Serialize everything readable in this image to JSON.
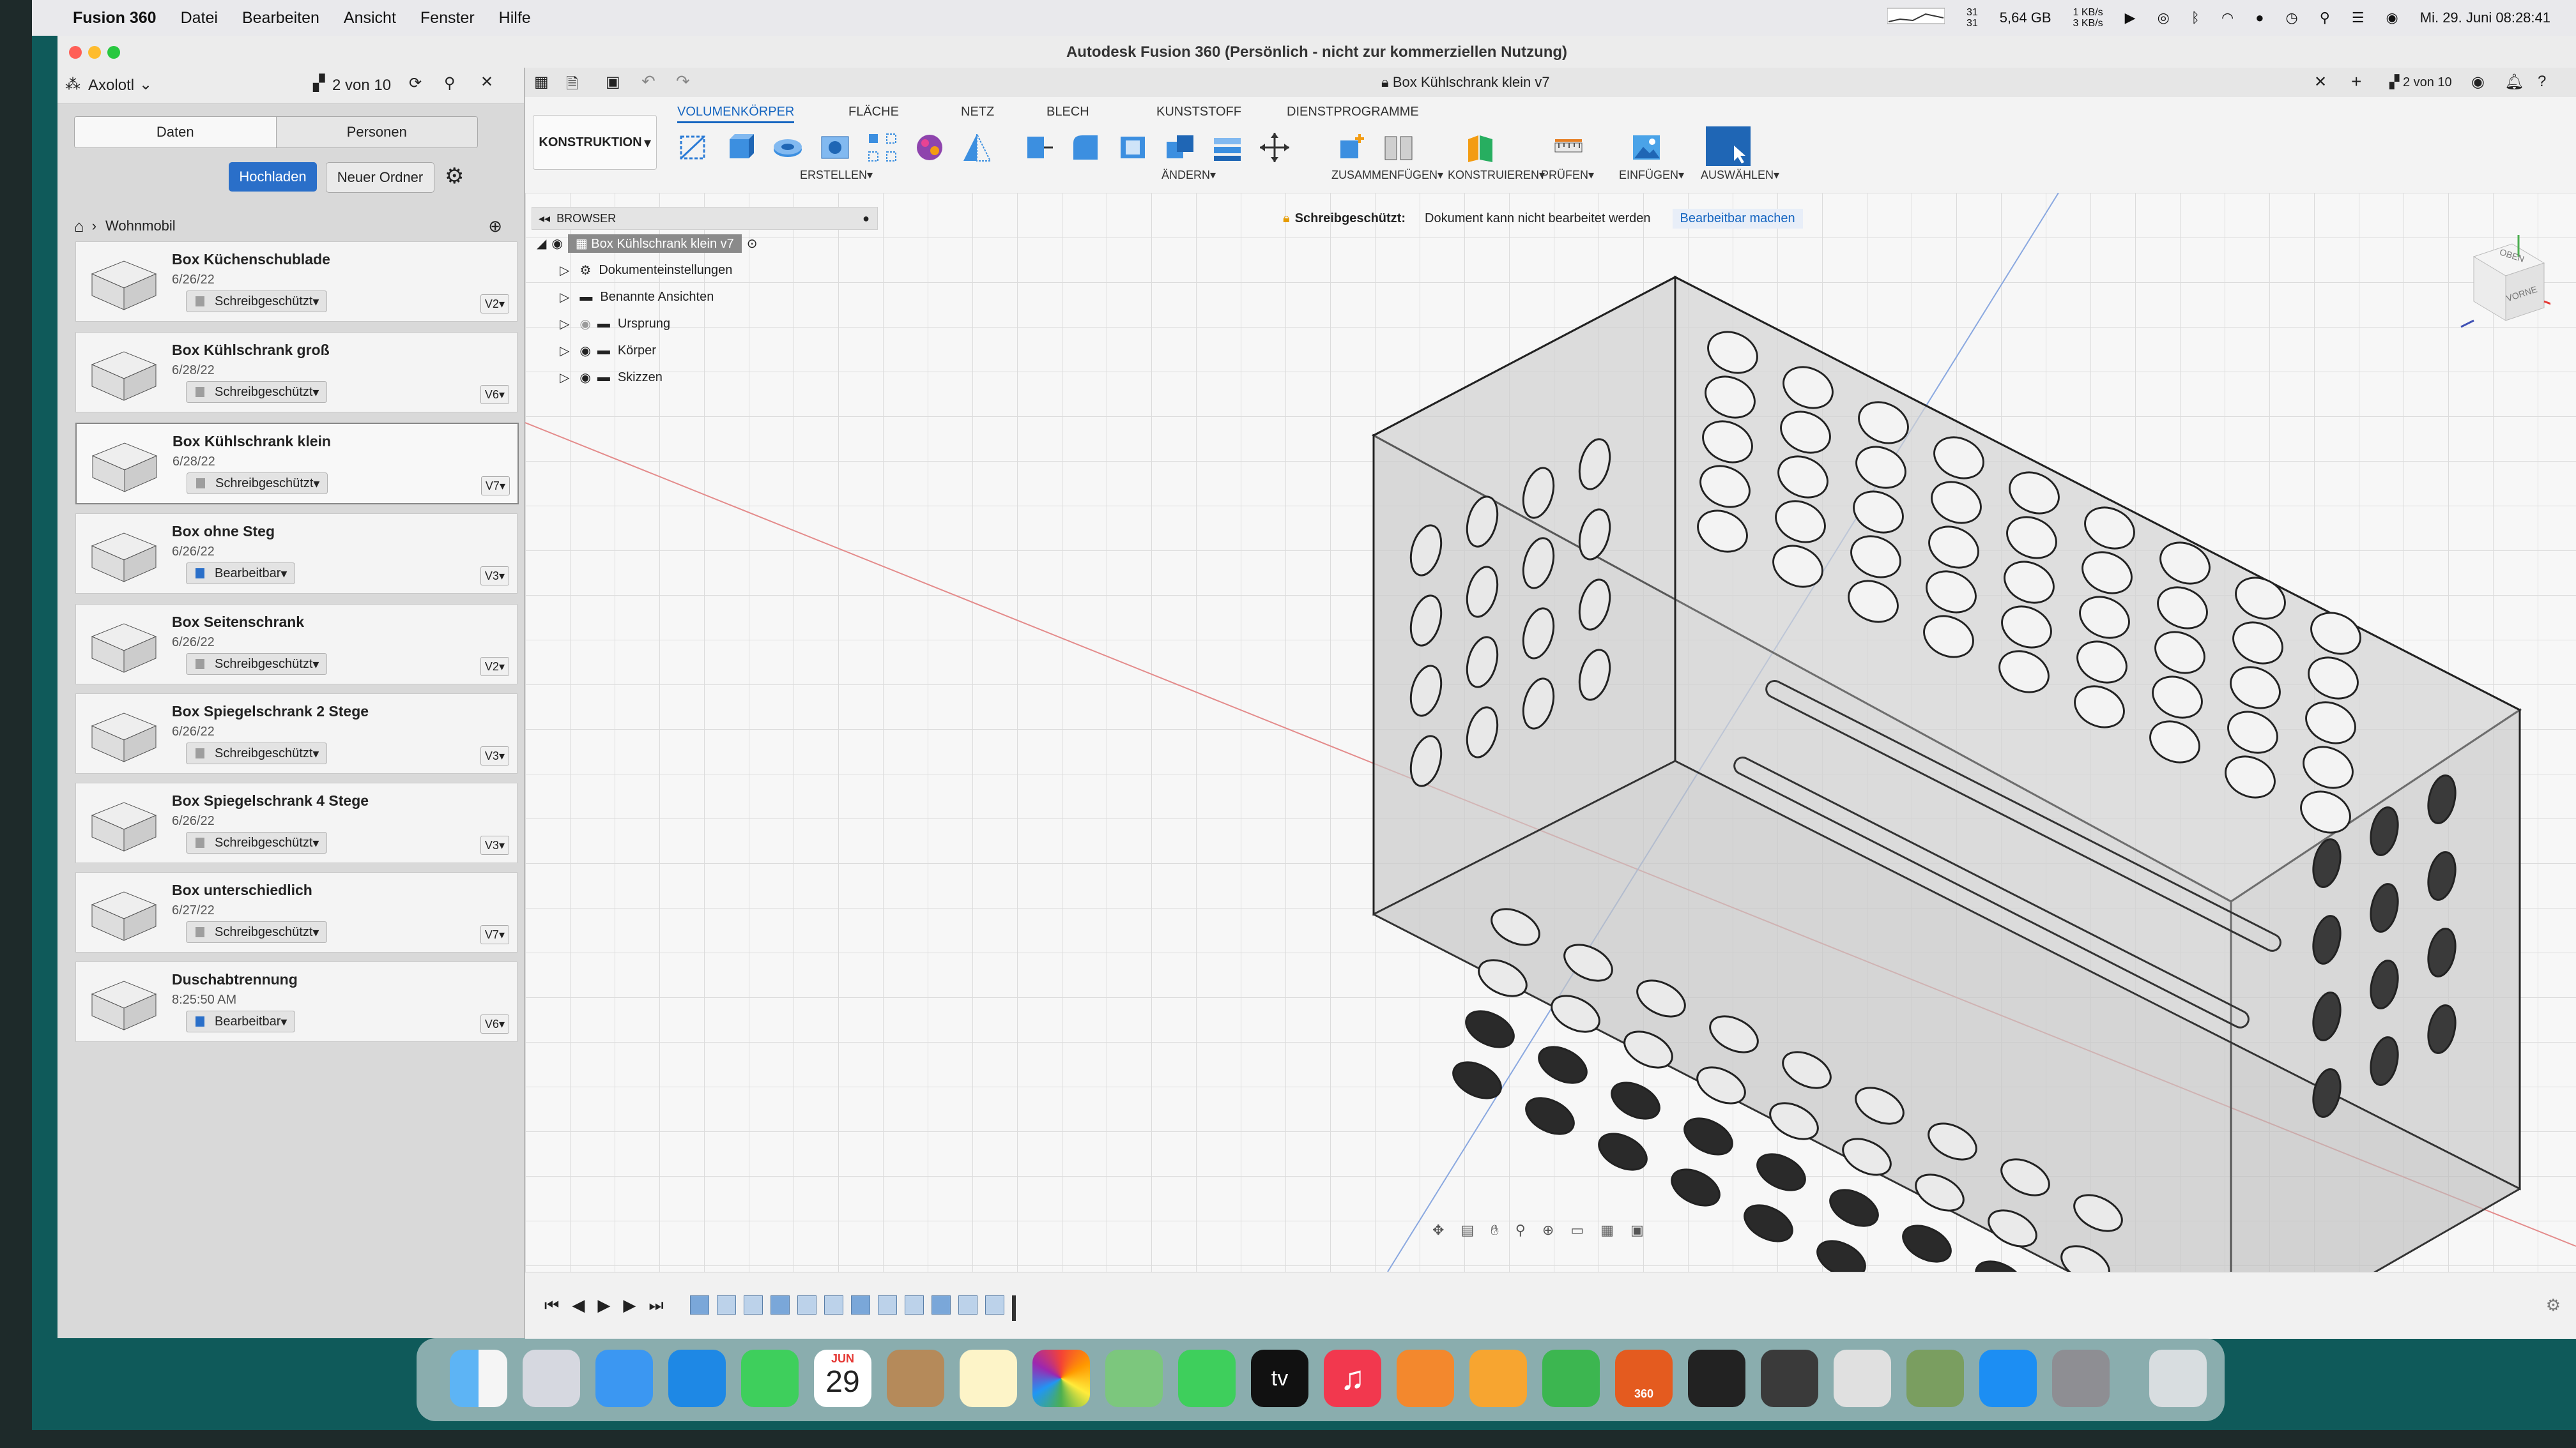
{
  "menubar": {
    "items": [
      "Fusion 360",
      "Datei",
      "Bearbeiten",
      "Ansicht",
      "Fenster",
      "Hilfe"
    ],
    "memory": "5,64 GB",
    "cpu": "31",
    "net_up": "1 KB/s",
    "net_down": "3 KB/s",
    "datetime": "Mi. 29. Juni 08:28:41"
  },
  "window": {
    "title": "Autodesk Fusion 360 (Persönlich - nicht zur kommerziellen Nutzung)"
  },
  "data_panel": {
    "project": "Axolotl",
    "counter": "2 von 10",
    "tabs": [
      "Daten",
      "Personen"
    ],
    "upload_label": "Hochladen",
    "new_folder_label": "Neuer Ordner",
    "breadcrumb": "Wohnmobil",
    "files": [
      {
        "name": "Box Küchenschublade",
        "date": "6/26/22",
        "status": "Schreibgeschützt",
        "version": "V2"
      },
      {
        "name": "Box Kühlschrank groß",
        "date": "6/28/22",
        "status": "Schreibgeschützt",
        "version": "V6"
      },
      {
        "name": "Box Kühlschrank klein",
        "date": "6/28/22",
        "status": "Schreibgeschützt",
        "version": "V7"
      },
      {
        "name": "Box ohne Steg",
        "date": "6/26/22",
        "status": "Bearbeitbar",
        "version": "V3"
      },
      {
        "name": "Box Seitenschrank",
        "date": "6/26/22",
        "status": "Schreibgeschützt",
        "version": "V2"
      },
      {
        "name": "Box Spiegelschrank 2 Stege",
        "date": "6/26/22",
        "status": "Schreibgeschützt",
        "version": "V3"
      },
      {
        "name": "Box Spiegelschrank 4 Stege",
        "date": "6/26/22",
        "status": "Schreibgeschützt",
        "version": "V3"
      },
      {
        "name": "Box unterschiedlich",
        "date": "6/27/22",
        "status": "Schreibgeschützt",
        "version": "V7"
      },
      {
        "name": "Duschabtrennung",
        "date": "8:25:50 AM",
        "status": "Bearbeitbar",
        "version": "V6"
      }
    ]
  },
  "doc": {
    "tab_title": "Box Kühlschrank klein v7",
    "counter": "2 von 10"
  },
  "toolbar": {
    "workspace": "KONSTRUKTION",
    "tabs": [
      "VOLUMENKÖRPER",
      "FLÄCHE",
      "NETZ",
      "BLECH",
      "KUNSTSTOFF",
      "DIENSTPROGRAMME"
    ],
    "groups": [
      "ERSTELLEN",
      "ÄNDERN",
      "ZUSAMMENFÜGEN",
      "KONSTRUIEREN",
      "PRÜFEN",
      "EINFÜGEN",
      "AUSWÄHLEN"
    ]
  },
  "browser": {
    "title": "BROWSER",
    "root": "Box Kühlschrank klein v7",
    "nodes": [
      "Dokumenteinstellungen",
      "Benannte Ansichten",
      "Ursprung",
      "Körper",
      "Skizzen"
    ]
  },
  "lockbar": {
    "label": "Schreibgeschützt:",
    "message": "Dokument kann nicht bearbeitet werden",
    "action": "Bearbeitbar machen"
  },
  "viewcube": {
    "top": "OBEN",
    "front": "VORNE"
  },
  "dock": {
    "calendar_month": "JUN",
    "calendar_day": "29",
    "fusion_badge": "360",
    "tv_label": "tv"
  },
  "colors": {
    "accent": "#1565c0",
    "desktop": "#0f5a5a",
    "upload_button": "#2a6fc9"
  }
}
